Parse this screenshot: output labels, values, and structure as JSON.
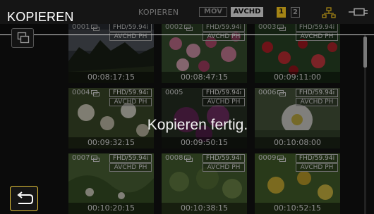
{
  "header": {
    "title": "KOPIEREN",
    "mode_label": "KOPIEREN",
    "format_mov": "MOV",
    "format_avchd": "AVCHD",
    "slot1": "1",
    "slot2": "2"
  },
  "message": "Kopieren fertig.",
  "thumbnails": [
    {
      "number": "0001",
      "format": "FHD/59.94i",
      "codec": "AVCHD PH",
      "duration": "00:08:17:15"
    },
    {
      "number": "0002",
      "format": "FHD/59.94i",
      "codec": "AVCHD PH",
      "duration": "00:08:47:15"
    },
    {
      "number": "0003",
      "format": "FHD/59.94i",
      "codec": "AVCHD PH",
      "duration": "00:09:11:00"
    },
    {
      "number": "0004",
      "format": "FHD/59.94i",
      "codec": "AVCHD PH",
      "duration": "00:09:32:15"
    },
    {
      "number": "0005",
      "format": "FHD/59.94i",
      "codec": "AVCHD PH",
      "duration": "00:09:50:15"
    },
    {
      "number": "0006",
      "format": "FHD/59.94i",
      "codec": "AVCHD PH",
      "duration": "00:10:08:00"
    },
    {
      "number": "0007",
      "format": "FHD/59.94i",
      "codec": "AVCHD PH",
      "duration": "00:10:20:15"
    },
    {
      "number": "0008",
      "format": "FHD/59.94i",
      "codec": "AVCHD PH",
      "duration": "00:10:38:15"
    },
    {
      "number": "0009",
      "format": "FHD/59.94i",
      "codec": "AVCHD PH",
      "duration": "00:10:52:15"
    }
  ],
  "icons": {
    "copy": "copy-icon",
    "back": "return-arrow-icon",
    "network": "network-icon",
    "battery": "battery-icon",
    "clip": "clip-icon"
  },
  "colors": {
    "accent": "#e4c237",
    "slot1_active": "#c9a21a",
    "avchd_selected": "#b5b5b5"
  }
}
